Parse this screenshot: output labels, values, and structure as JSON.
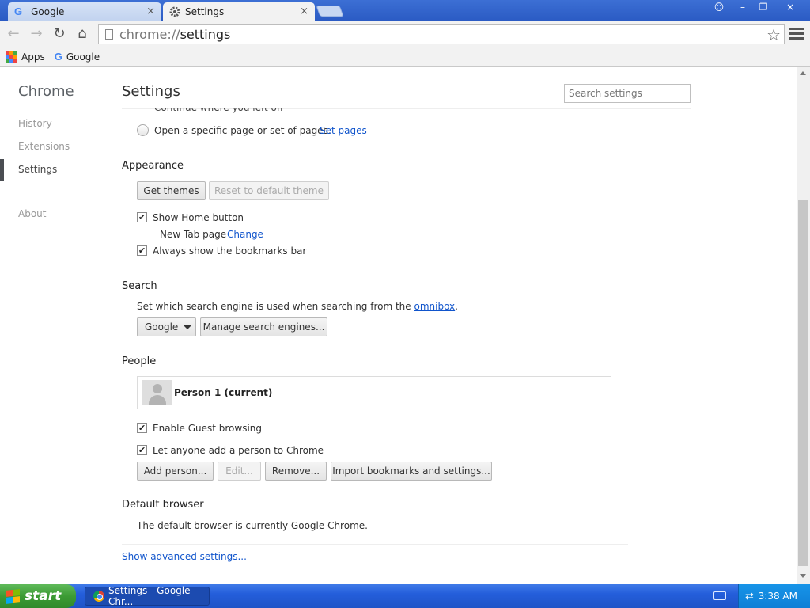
{
  "tabs": [
    {
      "label": "Google",
      "close": "×",
      "icon": "google-g-icon"
    },
    {
      "label": "Settings",
      "close": "×",
      "icon": "gear-icon"
    }
  ],
  "window_controls": {
    "user": "☺",
    "minimize": "–",
    "restore": "❐",
    "close": "×"
  },
  "toolbar": {
    "back": "←",
    "forward": "→",
    "reload": "↻",
    "home": "⌂",
    "url_scheme": "chrome://",
    "url_path": "settings",
    "star": "☆"
  },
  "bookmarks": {
    "apps": "Apps",
    "google": "Google",
    "google_letter": "G"
  },
  "sidebar": {
    "brand": "Chrome",
    "items": [
      {
        "label": "History"
      },
      {
        "label": "Extensions"
      },
      {
        "label": "Settings"
      },
      {
        "label": "About"
      }
    ]
  },
  "settings": {
    "title": "Settings",
    "search_placeholder": "Search settings",
    "startup": {
      "continue_label": "Continue where you left off",
      "specific_label": "Open a specific page or set of pages.",
      "set_pages_link": "Set pages"
    },
    "appearance": {
      "title": "Appearance",
      "get_themes": "Get themes",
      "reset_theme": "Reset to default theme",
      "show_home": "Show Home button",
      "show_home_checked": true,
      "new_tab_text": "New Tab page",
      "change_link": "Change",
      "bookmarks_bar": "Always show the bookmarks bar",
      "bookmarks_bar_checked": true
    },
    "search": {
      "title": "Search",
      "description": "Set which search engine is used when searching from the",
      "omnibox_link": "omnibox",
      "period": ".",
      "engine": "Google",
      "manage": "Manage search engines..."
    },
    "people": {
      "title": "People",
      "person": "Person 1 (current)",
      "guest": "Enable Guest browsing",
      "guest_checked": true,
      "anyone_add": "Let anyone add a person to Chrome",
      "anyone_add_checked": true,
      "add_person": "Add person...",
      "edit": "Edit...",
      "remove": "Remove...",
      "import": "Import bookmarks and settings..."
    },
    "default_browser": {
      "title": "Default browser",
      "description": "The default browser is currently Google Chrome."
    },
    "advanced_link": "Show advanced settings..."
  },
  "taskbar": {
    "start": "start",
    "task": "Settings - Google Chr...",
    "clock": "3:38 AM"
  },
  "colors": {
    "titlebar": "#2b5bc4",
    "link": "#1155cc",
    "taskbar": "#245edb",
    "start_green": "#3c9b34"
  }
}
